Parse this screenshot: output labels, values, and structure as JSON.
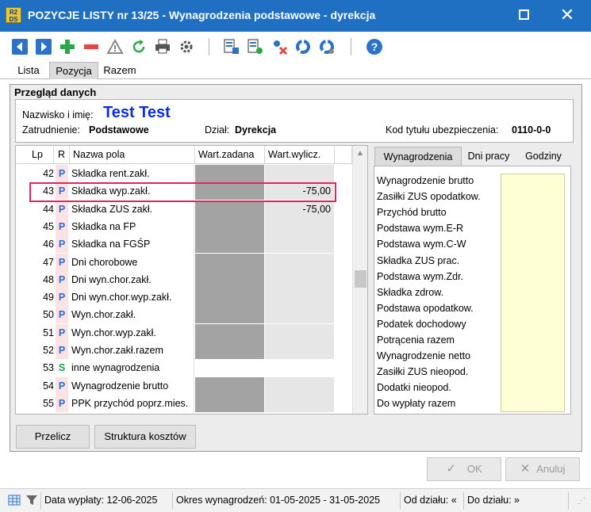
{
  "window": {
    "title": "POZYCJE LISTY nr 13/25 - Wynagrodzenia podstawowe - dyrekcja",
    "logo_text": "R2 DS"
  },
  "toolbar": {
    "icons": [
      "nav-back-icon",
      "nav-forward-icon",
      "add-icon",
      "remove-icon",
      "warning-icon",
      "refresh-icon",
      "print-icon",
      "settings-icon",
      "calc-icon",
      "calc-export-icon",
      "delete-icon",
      "circle-icon",
      "circle-export-icon",
      "help-icon"
    ]
  },
  "tabs": [
    "Lista",
    "Pozycja",
    "Razem"
  ],
  "active_tab": "Pozycja",
  "section_title": "Przegląd danych",
  "info": {
    "name_label": "Nazwisko i imię:",
    "name_value": "Test Test",
    "employment_label": "Zatrudnienie:",
    "employment_value": "Podstawowe",
    "department_label": "Dział:",
    "department_value": "Dyrekcja",
    "insurance_label": "Kod tytułu ubezpieczenia:",
    "insurance_value": "0110-0-0"
  },
  "grid": {
    "headers": {
      "lp": "Lp",
      "r": "R",
      "name": "Nazwa pola",
      "set": "Wart.zadana",
      "calc": "Wart.wylicz."
    },
    "rows": [
      {
        "lp": "42",
        "r": "P",
        "name": "Składka rent.zakł.",
        "set": "",
        "calc": ""
      },
      {
        "lp": "43",
        "r": "P",
        "name": "Składka wyp.zakł.",
        "set": "",
        "calc": "-75,00"
      },
      {
        "lp": "44",
        "r": "P",
        "name": "Składka ZUS zakł.",
        "set": "",
        "calc": "-75,00"
      },
      {
        "lp": "45",
        "r": "P",
        "name": "Składka na FP",
        "set": "",
        "calc": ""
      },
      {
        "lp": "46",
        "r": "P",
        "name": "Składka na FGŚP",
        "set": "",
        "calc": ""
      },
      {
        "lp": "47",
        "r": "P",
        "name": "Dni chorobowe",
        "set": "",
        "calc": ""
      },
      {
        "lp": "48",
        "r": "P",
        "name": "Dni wyn.chor.zakł.",
        "set": "",
        "calc": ""
      },
      {
        "lp": "49",
        "r": "P",
        "name": "Dni wyn.chor.wyp.zakł.",
        "set": "",
        "calc": ""
      },
      {
        "lp": "50",
        "r": "P",
        "name": "Wyn.chor.zakł.",
        "set": "",
        "calc": ""
      },
      {
        "lp": "51",
        "r": "P",
        "name": "Wyn.chor.wyp.zakł.",
        "set": "",
        "calc": ""
      },
      {
        "lp": "52",
        "r": "P",
        "name": "Wyn.chor.zakł.razem",
        "set": "",
        "calc": ""
      },
      {
        "lp": "53",
        "r": "S",
        "name": "inne wynagrodzenia",
        "set": "",
        "calc": ""
      },
      {
        "lp": "54",
        "r": "P",
        "name": "Wynagrodzenie brutto",
        "set": "",
        "calc": ""
      },
      {
        "lp": "55",
        "r": "P",
        "name": "PPK przychód poprz.mies.",
        "set": "",
        "calc": ""
      }
    ]
  },
  "right_panel": {
    "tabs": [
      "Wynagrodzenia",
      "Dni pracy",
      "Godziny"
    ],
    "active_tab": "Wynagrodzenia",
    "labels": [
      "Wynagrodzenie brutto",
      "Zasiłki ZUS opodatkow.",
      "Przychód brutto",
      "Podstawa wym.E-R",
      "Podstawa wym.C-W",
      "Składka ZUS prac.",
      "Podstawa wym.Zdr.",
      "Składka zdrow.",
      "Podstawa opodatkow.",
      "Podatek dochodowy",
      "Potrącenia razem",
      "Wynagrodzenie netto",
      "Zasiłki ZUS nieopod.",
      "Dodatki nieopod.",
      "Do wypłaty razem"
    ]
  },
  "buttons": {
    "recalc": "Przelicz",
    "cost_structure": "Struktura kosztów",
    "ok": "OK",
    "cancel": "Anuluj"
  },
  "statusbar": {
    "payment_date": "Data wypłaty: 12-06-2025",
    "period": "Okres wynagrodzeń: 01-05-2025 - 31-05-2025",
    "from_dept": "Od działu: «",
    "to_dept": "Do działu: »"
  },
  "colors": {
    "titlebar": "#1f6fc3",
    "name_value": "#0a2ee0",
    "highlight_border": "#e0245e",
    "readonly_cell": "#a3a3a3",
    "calc_cell": "#e6e6e6",
    "editable_cell": "#ffffff",
    "summary_field": "#ffffd6"
  }
}
